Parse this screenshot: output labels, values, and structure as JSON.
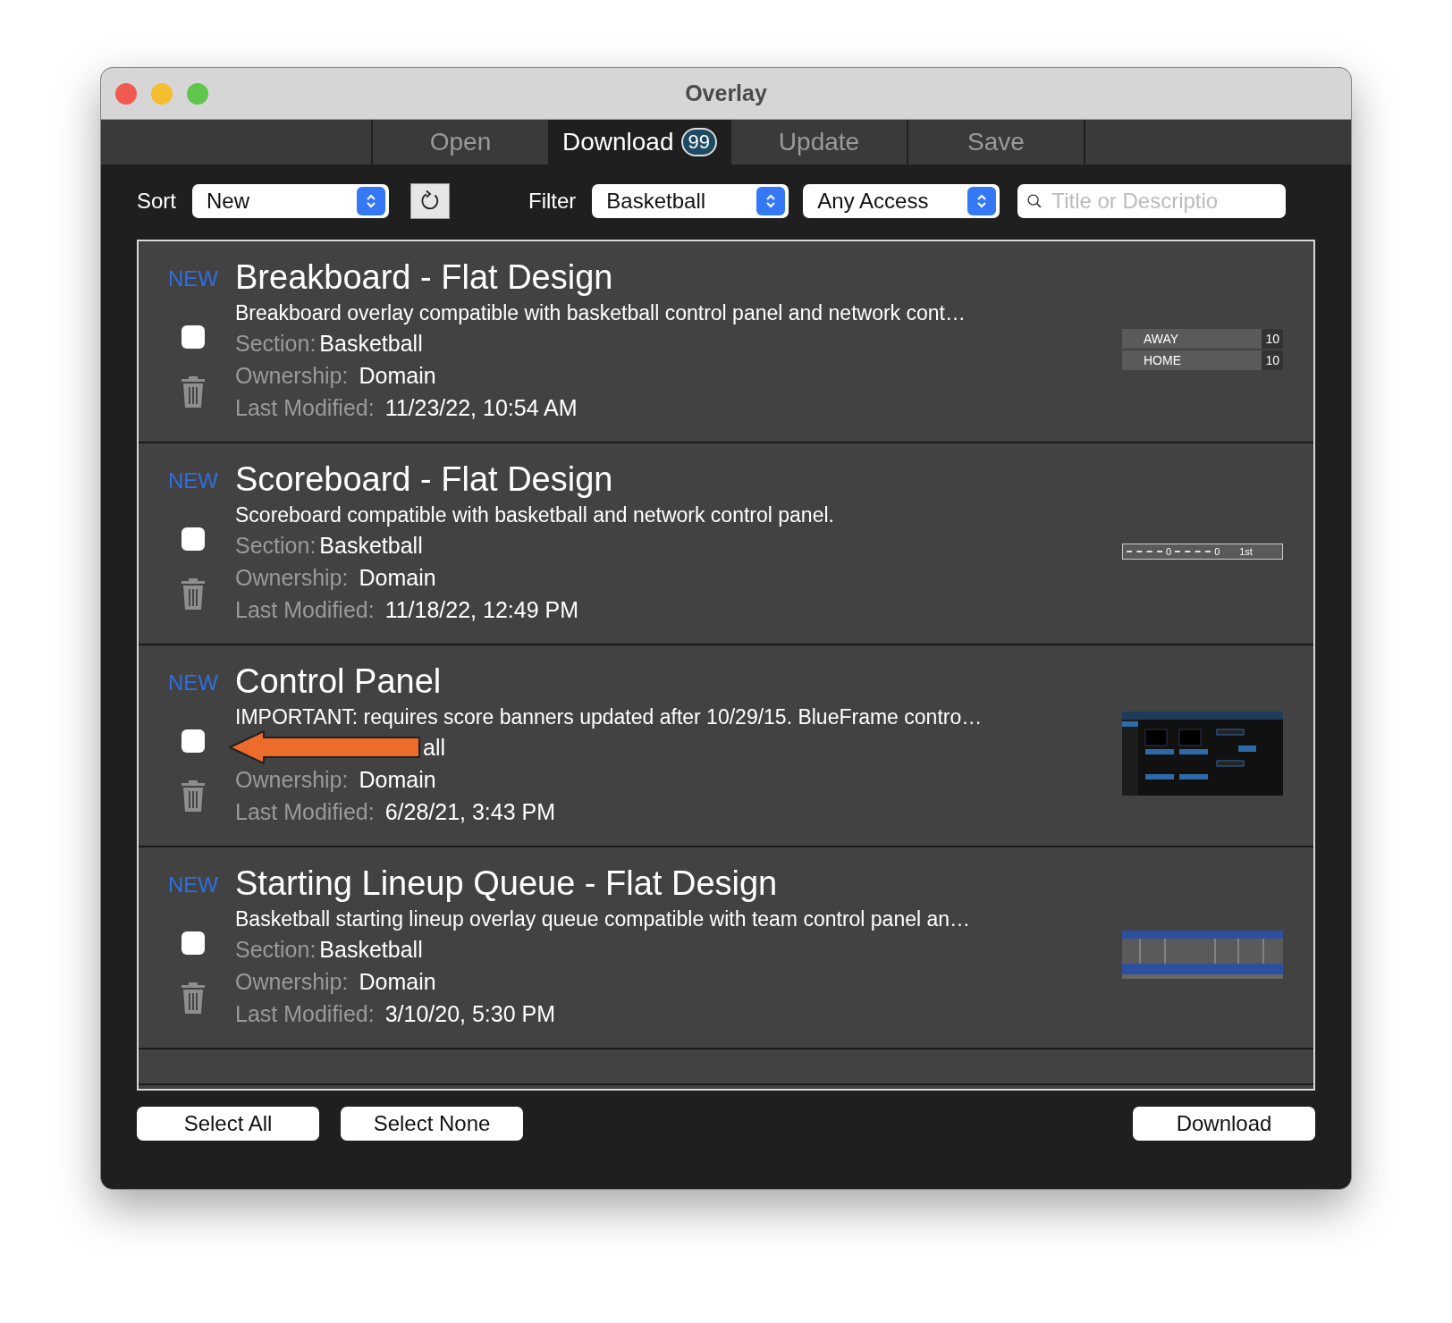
{
  "window": {
    "title": "Overlay"
  },
  "tabs": [
    {
      "label": "Open",
      "selected": false
    },
    {
      "label": "Download",
      "selected": true,
      "badge": "99"
    },
    {
      "label": "Update",
      "selected": false
    },
    {
      "label": "Save",
      "selected": false
    }
  ],
  "toolbar": {
    "sort_label": "Sort",
    "sort_value": "New",
    "filter_label": "Filter",
    "filter_value": "Basketball",
    "access_value": "Any Access",
    "search": {
      "placeholder": "Title or Descriptio"
    }
  },
  "items": [
    {
      "badge": "NEW",
      "title": "Breakboard - Flat Design",
      "description": "Breakboard overlay compatible with basketball control panel and network cont…",
      "checked": false,
      "section_label": "Section:",
      "section": "Basketball",
      "ownership_label": "Ownership:",
      "ownership": "Domain",
      "modified_label": "Last Modified:",
      "modified": "11/23/22, 10:54 AM",
      "thumbnail": {
        "kind": "banner",
        "rows": [
          {
            "team": "AWAY",
            "score": "10"
          },
          {
            "team": "HOME",
            "score": "10"
          }
        ]
      }
    },
    {
      "badge": "NEW",
      "title": "Scoreboard - Flat Design",
      "description": "Scoreboard compatible with basketball and network control panel.",
      "checked": false,
      "section_label": "Section:",
      "section": "Basketball",
      "ownership_label": "Ownership:",
      "ownership": "Domain",
      "modified_label": "Last Modified:",
      "modified": "11/18/22, 12:49 PM",
      "thumbnail": {
        "kind": "scorebug",
        "scores": [
          "0",
          "0"
        ],
        "period": "1st"
      }
    },
    {
      "badge": "NEW",
      "title": "Control Panel",
      "description": "IMPORTANT: requires score banners updated after 10/29/15. BlueFrame contro…",
      "checked": false,
      "section": "all",
      "ownership_label": "Ownership:",
      "ownership": "Domain",
      "modified_label": "Last Modified:",
      "modified": "6/28/21, 3:43 PM",
      "thumbnail": {
        "kind": "panel"
      },
      "callout_arrow": true
    },
    {
      "badge": "NEW",
      "title": "Starting Lineup Queue - Flat Design",
      "description": "Basketball starting lineup overlay queue compatible with team control panel an…",
      "checked": false,
      "section_label": "Section:",
      "section": "Basketball",
      "ownership_label": "Ownership:",
      "ownership": "Domain",
      "modified_label": "Last Modified:",
      "modified": "3/10/20, 5:30 PM",
      "thumbnail": {
        "kind": "lineup"
      }
    }
  ],
  "buttons": {
    "select_all": "Select All",
    "select_none": "Select None",
    "download": "Download"
  }
}
